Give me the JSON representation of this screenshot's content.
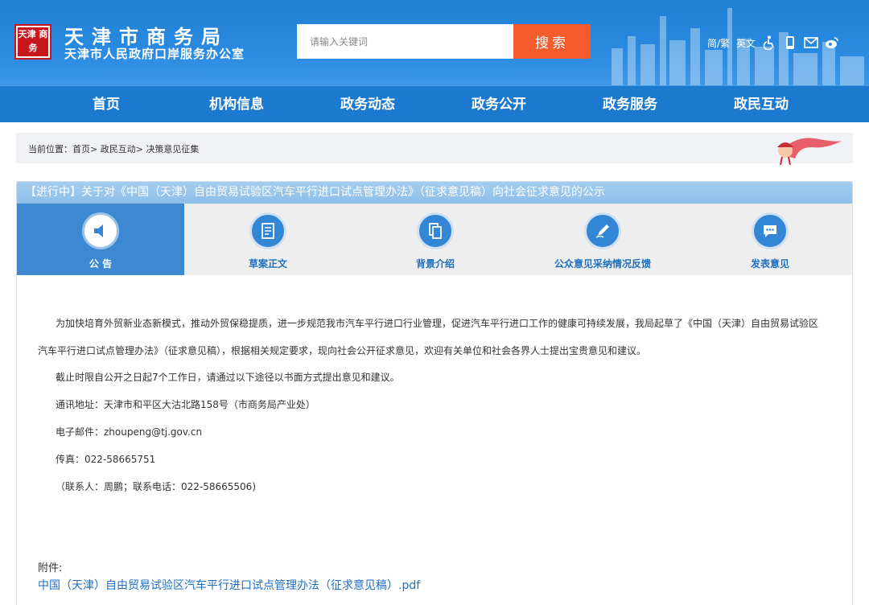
{
  "header": {
    "logo_text": "天津 商务",
    "title": "天津市商务局",
    "subtitle": "天津市人民政府口岸服务办公室",
    "search_placeholder": "请输入关键词",
    "search_button": "搜索",
    "lang_simple_trad": "简/繁",
    "lang_english": "英文",
    "icons": [
      "accessibility-icon",
      "mobile-icon",
      "mail-icon",
      "weibo-icon"
    ]
  },
  "nav": {
    "items": [
      "首页",
      "机构信息",
      "政务动态",
      "政务公开",
      "政务服务",
      "政民互动"
    ]
  },
  "breadcrumb": {
    "prefix": "当前位置：",
    "items": [
      "首页",
      "政民互动",
      "决策意见征集"
    ],
    "separator": ">"
  },
  "panel": {
    "title": "【进行中】关于对《中国（天津）自由贸易试验区汽车平行进口试点管理办法》（征求意见稿）向社会征求意见的公示",
    "tabs": [
      {
        "label": "公 告",
        "icon": "speaker-icon",
        "active": true
      },
      {
        "label": "草案正文",
        "icon": "document-icon",
        "active": false
      },
      {
        "label": "背景介绍",
        "icon": "copy-icon",
        "active": false
      },
      {
        "label": "公众意见采纳情况反馈",
        "icon": "pen-icon",
        "active": false
      },
      {
        "label": "发表意见",
        "icon": "chat-icon",
        "active": false
      }
    ],
    "body": {
      "p1_line1": "为加快培育外贸新业态新模式，推动外贸保稳提质，进一步规范我市汽车平行进口行业管理，促进汽车平行进口工作的健康可持续发展，我局起草了《中国（天津）自由贸易试验区",
      "p1_line2": "汽车平行进口试点管理办法》（征求意见稿），根据相关规定要求，现向社会公开征求意见，欢迎有关单位和社会各界人士提出宝贵意见和建议。",
      "p2": "截止时限自公开之日起7个工作日，请通过以下途径以书面方式提出意见和建议。",
      "address": "通讯地址：天津市和平区大沽北路158号（市商务局产业处）",
      "email": "电子邮件：zhoupeng@tj.gov.cn",
      "fax": "传真：022-58665751",
      "contact": "（联系人：周鹏；联系电话：022-58665506)"
    },
    "attachment_label": "附件:",
    "attachment_link": "中国（天津）自由贸易试验区汽车平行进口试点管理办法（征求意见稿）.pdf"
  },
  "colors": {
    "header_blue": "#2a8ae0",
    "nav_blue": "#1b7ad0",
    "search_orange": "#f35a2c",
    "active_tab": "#3c88d1",
    "link_blue": "#1e6fc2"
  }
}
